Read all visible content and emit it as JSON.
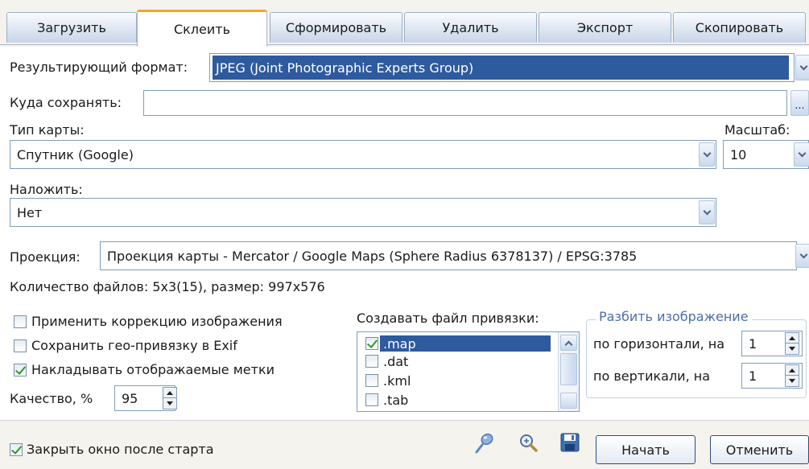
{
  "tabs": [
    {
      "label": "Загрузить"
    },
    {
      "label": "Склеить"
    },
    {
      "label": "Сформировать"
    },
    {
      "label": "Удалить"
    },
    {
      "label": "Экспорт"
    },
    {
      "label": "Скопировать"
    }
  ],
  "result_format": {
    "label": "Результирующий формат:",
    "value": "JPEG (Joint Photographic Experts Group)"
  },
  "save_to": {
    "label": "Куда сохранять:",
    "value": "",
    "browse_label": "..."
  },
  "map_type": {
    "label": "Тип карты:",
    "value": "Спутник (Google)"
  },
  "scale": {
    "label": "Масштаб:",
    "value": "10"
  },
  "overlay": {
    "label": "Наложить:",
    "value": "Нет"
  },
  "projection": {
    "label": "Проекция:",
    "value": "Проекция карты - Mercator / Google Maps (Sphere Radius 6378137) / EPSG:3785"
  },
  "file_info": "Количество файлов: 5x3(15), размер: 997x576",
  "options": [
    {
      "label": "Применить коррекцию изображения",
      "checked": false
    },
    {
      "label": "Сохранить гео-привязку в Exif",
      "checked": false
    },
    {
      "label": "Накладывать отображаемые метки",
      "checked": true
    }
  ],
  "quality": {
    "label": "Качество, %",
    "value": "95"
  },
  "binding": {
    "label": "Создавать файл привязки:",
    "items": [
      {
        "label": ".map",
        "checked": true
      },
      {
        "label": ".dat",
        "checked": false
      },
      {
        "label": ".kml",
        "checked": false
      },
      {
        "label": ".tab",
        "checked": false
      }
    ]
  },
  "split": {
    "title": "Разбить изображение",
    "horizontal_label": "по горизонтали, на",
    "horizontal_value": "1",
    "vertical_label": "по вертикали, на",
    "vertical_value": "1"
  },
  "footer": {
    "close_after_start_label": "Закрыть окно после старта",
    "close_after_start_checked": true,
    "start_button": "Начать",
    "cancel_button": "Отменить"
  },
  "colors": {
    "accent_tab": "#f5a623",
    "selection": "#2e5a9e",
    "group_title": "#4a6fa8"
  }
}
